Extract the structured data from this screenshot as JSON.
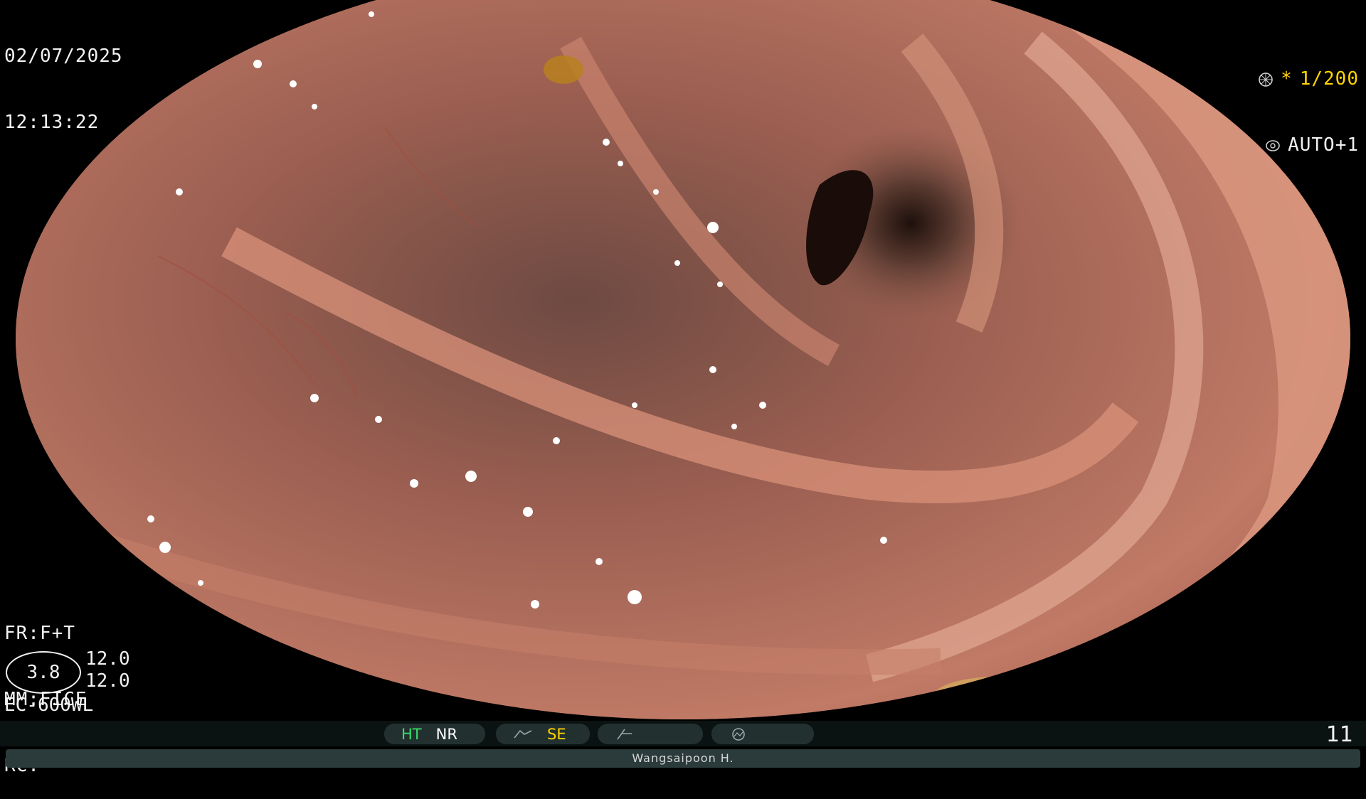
{
  "overlay": {
    "date": "02/07/2025",
    "time": "12:13:22",
    "shutter": "1/200",
    "shutter_prefix": "*",
    "iris_mode": "AUTO+1",
    "fr": "FR:F+T",
    "mm": "MM:FICE",
    "rc": "RC:",
    "ring_value": "3.8",
    "value_1": "12.0",
    "value_2": "12.0",
    "model": "EC-600WL",
    "counter": "11",
    "operator": "Wangsaipoon H."
  },
  "status_bar": {
    "ht": "HT",
    "nr": "NR",
    "se": "SE"
  },
  "colors": {
    "mucosa": "#b87462",
    "ht": "#38e06a",
    "se": "#ffd400",
    "text": "#f2f2f2"
  },
  "icons": [
    "shutter-icon",
    "iris-icon",
    "se-curve-icon",
    "nr-curve-icon",
    "color-icon"
  ]
}
